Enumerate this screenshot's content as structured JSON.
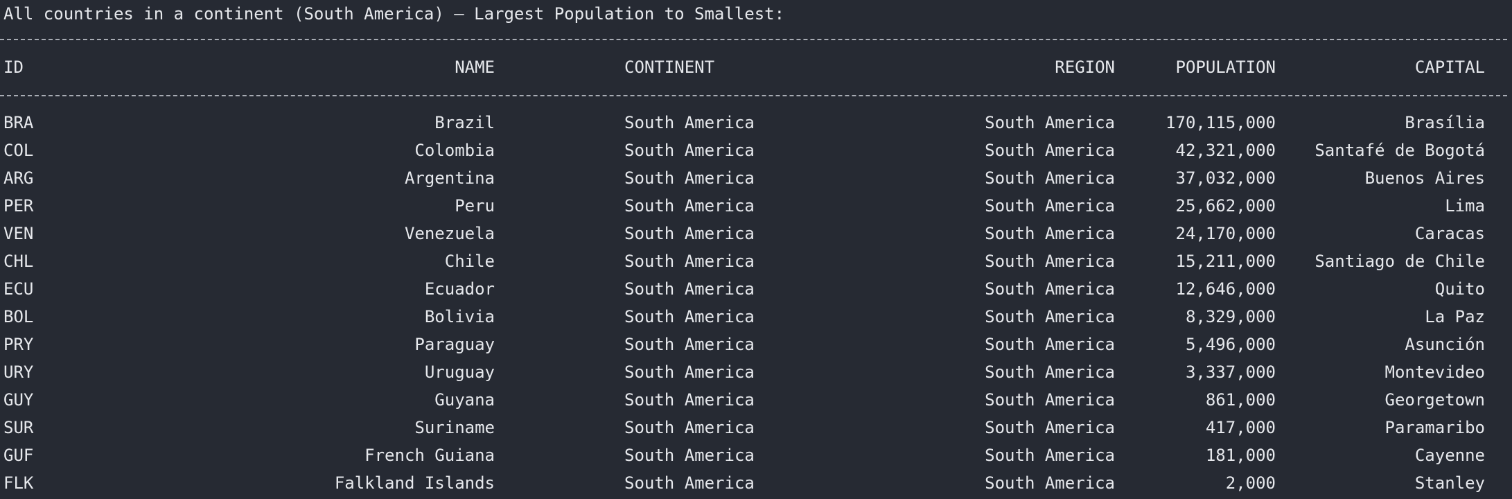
{
  "heading": "All countries in a continent (South America) – Largest Population to Smallest:",
  "columns": {
    "id": "ID",
    "name": "NAME",
    "continent": "CONTINENT",
    "region": "REGION",
    "population": "POPULATION",
    "capital": "CAPITAL"
  },
  "rows": [
    {
      "id": "BRA",
      "name": "Brazil",
      "continent": "South America",
      "region": "South America",
      "population": "170,115,000",
      "capital": "Brasília"
    },
    {
      "id": "COL",
      "name": "Colombia",
      "continent": "South America",
      "region": "South America",
      "population": "42,321,000",
      "capital": "Santafé de Bogotá"
    },
    {
      "id": "ARG",
      "name": "Argentina",
      "continent": "South America",
      "region": "South America",
      "population": "37,032,000",
      "capital": "Buenos Aires"
    },
    {
      "id": "PER",
      "name": "Peru",
      "continent": "South America",
      "region": "South America",
      "population": "25,662,000",
      "capital": "Lima"
    },
    {
      "id": "VEN",
      "name": "Venezuela",
      "continent": "South America",
      "region": "South America",
      "population": "24,170,000",
      "capital": "Caracas"
    },
    {
      "id": "CHL",
      "name": "Chile",
      "continent": "South America",
      "region": "South America",
      "population": "15,211,000",
      "capital": "Santiago de Chile"
    },
    {
      "id": "ECU",
      "name": "Ecuador",
      "continent": "South America",
      "region": "South America",
      "population": "12,646,000",
      "capital": "Quito"
    },
    {
      "id": "BOL",
      "name": "Bolivia",
      "continent": "South America",
      "region": "South America",
      "population": "8,329,000",
      "capital": "La Paz"
    },
    {
      "id": "PRY",
      "name": "Paraguay",
      "continent": "South America",
      "region": "South America",
      "population": "5,496,000",
      "capital": "Asunción"
    },
    {
      "id": "URY",
      "name": "Uruguay",
      "continent": "South America",
      "region": "South America",
      "population": "3,337,000",
      "capital": "Montevideo"
    },
    {
      "id": "GUY",
      "name": "Guyana",
      "continent": "South America",
      "region": "South America",
      "population": "861,000",
      "capital": "Georgetown"
    },
    {
      "id": "SUR",
      "name": "Suriname",
      "continent": "South America",
      "region": "South America",
      "population": "417,000",
      "capital": "Paramaribo"
    },
    {
      "id": "GUF",
      "name": "French Guiana",
      "continent": "South America",
      "region": "South America",
      "population": "181,000",
      "capital": "Cayenne"
    },
    {
      "id": "FLK",
      "name": "Falkland Islands",
      "continent": "South America",
      "region": "South America",
      "population": "2,000",
      "capital": "Stanley"
    }
  ]
}
